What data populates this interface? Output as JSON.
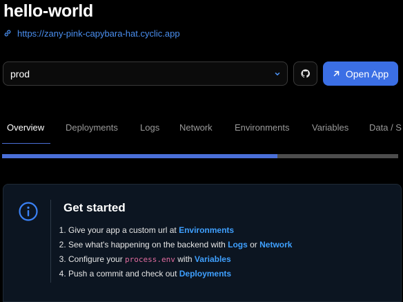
{
  "app": {
    "title": "hello-world",
    "url": "https://zany-pink-capybara-hat.cyclic.app"
  },
  "env_select": {
    "value": "prod"
  },
  "open_button": {
    "label": "Open App"
  },
  "tabs": [
    {
      "label": "Overview",
      "active": true
    },
    {
      "label": "Deployments"
    },
    {
      "label": "Logs"
    },
    {
      "label": "Network"
    },
    {
      "label": "Environments"
    },
    {
      "label": "Variables"
    },
    {
      "label": "Data / S"
    }
  ],
  "progress": {
    "fraction": 0.695
  },
  "get_started": {
    "heading": "Get started",
    "steps": [
      {
        "text_a": "Give your app a custom url at ",
        "link_a": "Environments"
      },
      {
        "text_a": "See what's happening on the backend with ",
        "link_a": "Logs",
        "text_b": " or ",
        "link_b": "Network"
      },
      {
        "text_a": "Configure your ",
        "code": "process.env",
        "text_b": " with ",
        "link_a": "Variables"
      },
      {
        "text_a": "Push a commit and check out ",
        "link_a": "Deployments"
      }
    ]
  },
  "colors": {
    "accent": "#3b6fe5",
    "link": "#3fa0ff",
    "code": "#e06c9f"
  },
  "icons": [
    "link-icon",
    "chevron-down-icon",
    "github-icon",
    "arrow-up-right-icon",
    "info-icon"
  ]
}
